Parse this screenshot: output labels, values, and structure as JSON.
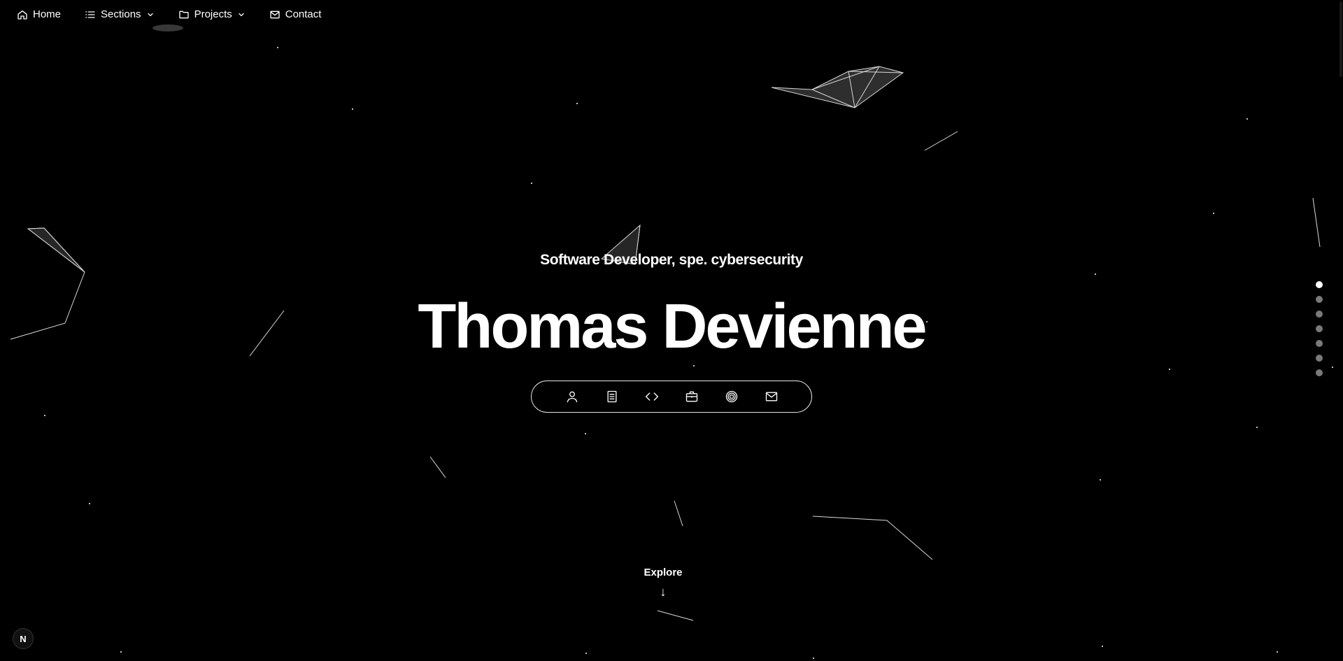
{
  "nav": {
    "home": {
      "label": "Home",
      "icon": "home-icon"
    },
    "sections": {
      "label": "Sections",
      "icon": "list-icon"
    },
    "projects": {
      "label": "Projects",
      "icon": "folder-icon"
    },
    "contact": {
      "label": "Contact",
      "icon": "mail-icon"
    }
  },
  "hero": {
    "subtitle": "Software Developer, spe. cybersecurity",
    "title": "Thomas Devienne"
  },
  "iconbar": {
    "items": [
      "user-icon",
      "document-icon",
      "code-icon",
      "briefcase-icon",
      "target-icon",
      "mail-icon"
    ]
  },
  "explore": {
    "label": "Explore",
    "arrow": "↓"
  },
  "section_dots": {
    "count": 7,
    "active_index": 0
  },
  "badge": {
    "label": "N"
  },
  "colors": {
    "background": "#000000",
    "text": "#ffffff",
    "dot_inactive": "#7a7a7a",
    "dot_active": "#ffffff"
  }
}
